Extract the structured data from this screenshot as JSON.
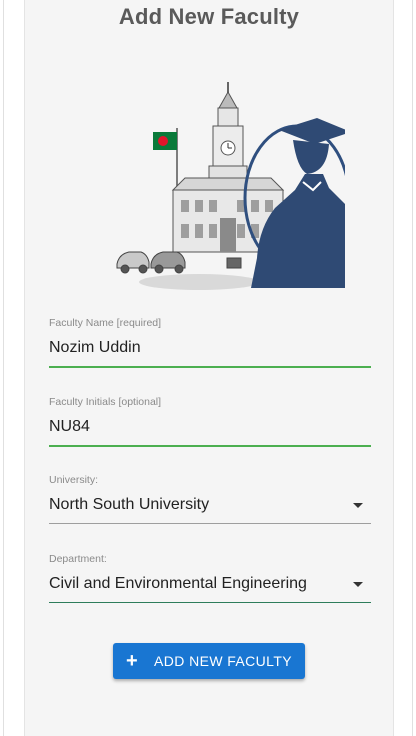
{
  "page": {
    "title": "Add New Faculty"
  },
  "form": {
    "faculty_name": {
      "label": "Faculty Name [required]",
      "value": "Nozim Uddin"
    },
    "faculty_initials": {
      "label": "Faculty Initials [optional]",
      "value": "NU84"
    },
    "university": {
      "label": "University:",
      "value": "North South University"
    },
    "department": {
      "label": "Department:",
      "value": "Civil and Environmental Engineering"
    }
  },
  "actions": {
    "submit_label": "ADD NEW FACULTY",
    "submit_icon": "+"
  },
  "colors": {
    "accent_green": "#4caf50",
    "button_blue": "#1976d2",
    "teal_underline": "#2e7d5b"
  },
  "icons": {
    "illustration": "university-graduate-illustration",
    "dropdown": "caret-down-icon",
    "add": "plus-icon"
  }
}
